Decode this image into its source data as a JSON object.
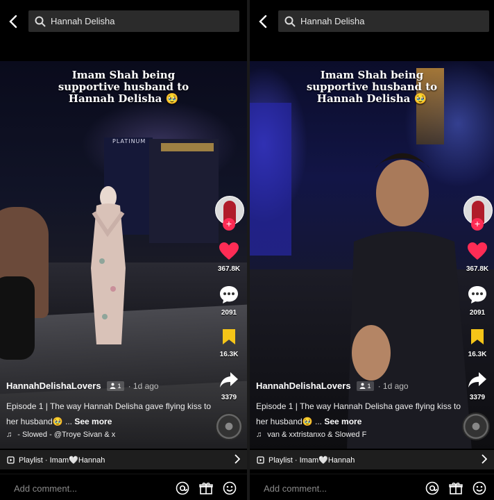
{
  "panels": [
    {
      "search_query": "Hannah Delisha",
      "caption_lines": [
        "Imam Shah being",
        "supportive husband to",
        "Hannah Delisha 🥹"
      ],
      "venue_sign": "PLATINUM",
      "likes": "367.8K",
      "comments": "2091",
      "saves": "16.3K",
      "shares": "3379",
      "username": "HannahDelishaLovers",
      "friends_badge": "1",
      "posted": "· 1d ago",
      "description": "Episode 1 | The way Hannah Delisha gave flying kiss to her husband🥹 ...",
      "see_more": "See more",
      "music": "- Slowed - @Troye Sivan & x",
      "playlist": "Playlist · Imam🤍Hannah",
      "comment_placeholder": "Add comment..."
    },
    {
      "search_query": "Hannah Delisha",
      "caption_lines": [
        "Imam Shah being",
        "supportive husband to",
        "Hannah Delisha 🥹"
      ],
      "likes": "367.8K",
      "comments": "2091",
      "saves": "16.3K",
      "shares": "3379",
      "username": "HannahDelishaLovers",
      "friends_badge": "1",
      "posted": "· 1d ago",
      "description": "Episode 1 | The way Hannah Delisha gave flying kiss to her husband🥹 ...",
      "see_more": "See more",
      "music": "van & xxtristanxo & Slowed F",
      "playlist": "Playlist · Imam🤍Hannah",
      "comment_placeholder": "Add comment..."
    }
  ],
  "icons": [
    "back-arrow-icon",
    "search-icon",
    "heart-icon",
    "comment-icon",
    "bookmark-icon",
    "share-icon",
    "music-note-icon",
    "playlist-icon",
    "chevron-right-icon",
    "mention-icon",
    "gift-icon",
    "emoji-icon"
  ],
  "colors": {
    "like": "#fe2c55",
    "save": "#f5c518",
    "plus": "#fe2c55"
  }
}
